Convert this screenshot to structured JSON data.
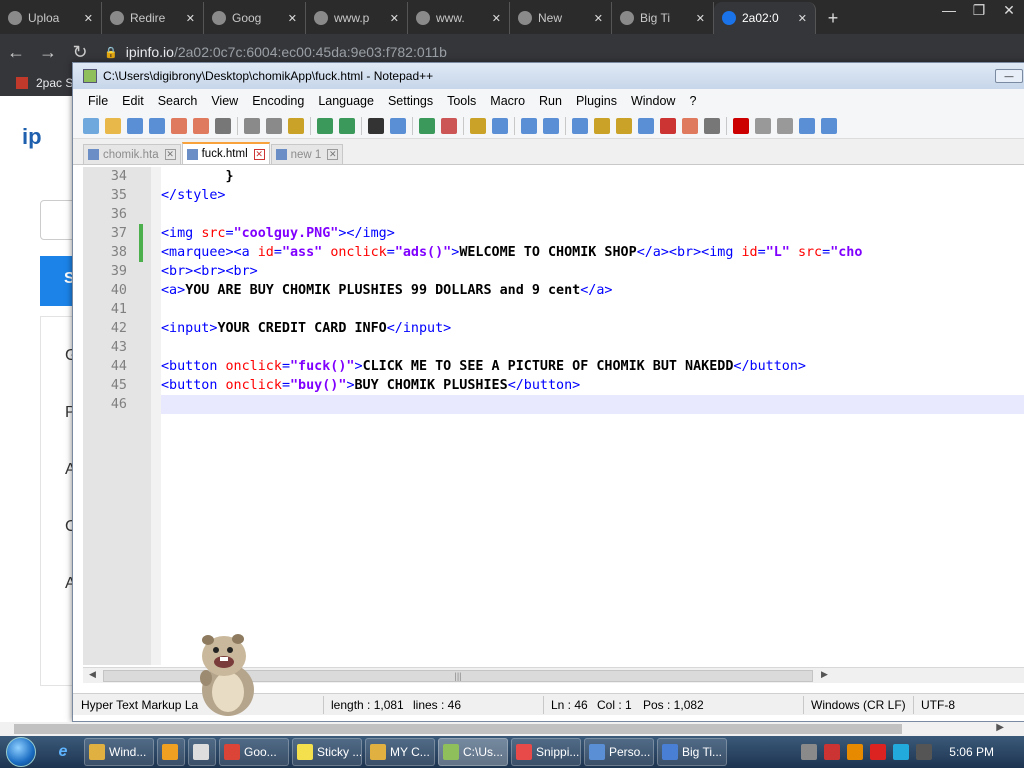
{
  "browser": {
    "tabs": [
      {
        "label": "Uploa",
        "active": false
      },
      {
        "label": "Redire",
        "active": false
      },
      {
        "label": "Goog",
        "active": false
      },
      {
        "label": "www.p",
        "active": false
      },
      {
        "label": "www.",
        "active": false
      },
      {
        "label": "New",
        "active": false
      },
      {
        "label": "Big Ti",
        "active": false
      },
      {
        "label": "2a02:0",
        "active": true
      }
    ],
    "url_host": "ipinfo.io",
    "url_path": "/2a02:0c7c:6004:ec00:45da:9e03:f782:011b",
    "bookmark_label": "2pac S"
  },
  "ipinfo": {
    "logo": "ip",
    "search_button": "S",
    "menu_letters": [
      "G",
      "P",
      "A",
      "C",
      "A"
    ]
  },
  "notepad": {
    "title": "C:\\Users\\digibrony\\Desktop\\chomikApp\\fuck.html - Notepad++",
    "menu": [
      "File",
      "Edit",
      "Search",
      "View",
      "Encoding",
      "Language",
      "Settings",
      "Tools",
      "Macro",
      "Run",
      "Plugins",
      "Window",
      "?"
    ],
    "tabs": [
      {
        "label": "chomik.hta",
        "active": false
      },
      {
        "label": "fuck.html",
        "active": true
      },
      {
        "label": "new 1",
        "active": false
      }
    ],
    "lines": [
      {
        "no": "34",
        "segs": [
          [
            "txt",
            "        }"
          ]
        ]
      },
      {
        "no": "35",
        "segs": [
          [
            "tag",
            "</style>"
          ]
        ]
      },
      {
        "no": "36",
        "segs": []
      },
      {
        "no": "37",
        "segs": [
          [
            "tag",
            "<img "
          ],
          [
            "atn",
            "src"
          ],
          [
            "tag",
            "="
          ],
          [
            "atv",
            "\"coolguy.PNG\""
          ],
          [
            "tag",
            "></img>"
          ]
        ]
      },
      {
        "no": "38",
        "segs": [
          [
            "tag",
            "<marquee><a "
          ],
          [
            "atn",
            "id"
          ],
          [
            "tag",
            "="
          ],
          [
            "atv",
            "\"ass\""
          ],
          [
            "tag",
            " "
          ],
          [
            "atn",
            "onclick"
          ],
          [
            "tag",
            "="
          ],
          [
            "atv",
            "\"ads()\""
          ],
          [
            "tag",
            ">"
          ],
          [
            "txt",
            "WELCOME TO CHOMIK SHOP"
          ],
          [
            "tag",
            "</a><br><img "
          ],
          [
            "atn",
            "id"
          ],
          [
            "tag",
            "="
          ],
          [
            "atv",
            "\"L\""
          ],
          [
            "tag",
            " "
          ],
          [
            "atn",
            "src"
          ],
          [
            "tag",
            "="
          ],
          [
            "atv",
            "\"cho"
          ]
        ]
      },
      {
        "no": "39",
        "segs": [
          [
            "tag",
            "<br><br><br>"
          ]
        ]
      },
      {
        "no": "40",
        "segs": [
          [
            "tag",
            "<a>"
          ],
          [
            "txt",
            "YOU ARE BUY CHOMIK PLUSHIES 99 DOLLARS and 9 cent"
          ],
          [
            "tag",
            "</a>"
          ]
        ]
      },
      {
        "no": "41",
        "segs": []
      },
      {
        "no": "42",
        "segs": [
          [
            "tag",
            "<input>"
          ],
          [
            "txt",
            "YOUR CREDIT CARD INFO"
          ],
          [
            "tag",
            "</input>"
          ]
        ]
      },
      {
        "no": "43",
        "segs": []
      },
      {
        "no": "44",
        "segs": [
          [
            "tag",
            "<button "
          ],
          [
            "atn",
            "onclick"
          ],
          [
            "tag",
            "="
          ],
          [
            "atv",
            "\"fuck()\""
          ],
          [
            "tag",
            ">"
          ],
          [
            "txt",
            "CLICK ME TO SEE A PICTURE OF CHOMIK BUT NAKEDD"
          ],
          [
            "tag",
            "</button>"
          ]
        ]
      },
      {
        "no": "45",
        "segs": [
          [
            "tag",
            "<button "
          ],
          [
            "atn",
            "onclick"
          ],
          [
            "tag",
            "="
          ],
          [
            "atv",
            "\"buy()\""
          ],
          [
            "tag",
            ">"
          ],
          [
            "txt",
            "BUY CHOMIK PLUSHIES"
          ],
          [
            "tag",
            "</button>"
          ]
        ]
      },
      {
        "no": "46",
        "segs": []
      }
    ],
    "status": {
      "lang": "Hyper Text Markup La",
      "length": "length : 1,081",
      "lines": "lines : 46",
      "ln": "Ln : 46",
      "col": "Col : 1",
      "pos": "Pos : 1,082",
      "eol": "Windows (CR LF)",
      "enc": "UTF-8"
    }
  },
  "taskbar": {
    "items": [
      {
        "label": "Wind...",
        "color": "#e0b040"
      },
      {
        "label": "",
        "color": "#f0a020"
      },
      {
        "label": "",
        "color": "#ddd"
      },
      {
        "label": "Goo...",
        "color": "#db4437"
      },
      {
        "label": "Sticky ...",
        "color": "#f4e04d"
      },
      {
        "label": "MY C...",
        "color": "#e0b040"
      },
      {
        "label": "C:\\Us...",
        "color": "#8fbf5a"
      },
      {
        "label": "Snippi...",
        "color": "#e84a4a"
      },
      {
        "label": "Perso...",
        "color": "#5a8fd6"
      },
      {
        "label": "Big Ti...",
        "color": "#4a7fd6"
      }
    ],
    "clock": "5:06 PM"
  }
}
